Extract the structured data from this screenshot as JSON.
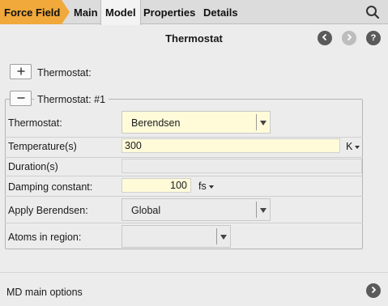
{
  "tabs": {
    "force_field": "Force Field",
    "main": "Main",
    "model": "Model",
    "properties": "Properties",
    "details": "Details"
  },
  "panel": {
    "title": "Thermostat"
  },
  "thermostat_add_label": "Thermostat:",
  "thermostat_group_label": "Thermostat: #1",
  "form": {
    "thermostat_label": "Thermostat:",
    "thermostat_value": "Berendsen",
    "temperature_label": "Temperature(s)",
    "temperature_value": "300",
    "temperature_unit": "K",
    "duration_label": "Duration(s)",
    "duration_value": "",
    "damping_label": "Damping constant:",
    "damping_value": "100",
    "damping_unit": "fs",
    "apply_label": "Apply Berendsen:",
    "apply_value": "Global",
    "atoms_label": "Atoms in region:",
    "atoms_value": ""
  },
  "footer": {
    "label": "MD main options"
  },
  "colors": {
    "force_field_tab": "#f0a93a",
    "input_background": "#fffbd9",
    "disabled_background": "#ebebeb"
  },
  "icons": {
    "search": "search-icon",
    "back": "chevron-left-icon",
    "forward": "chevron-right-icon",
    "help": "question-icon",
    "add": "plus-icon",
    "remove": "minus-icon",
    "next": "chevron-right-icon"
  }
}
